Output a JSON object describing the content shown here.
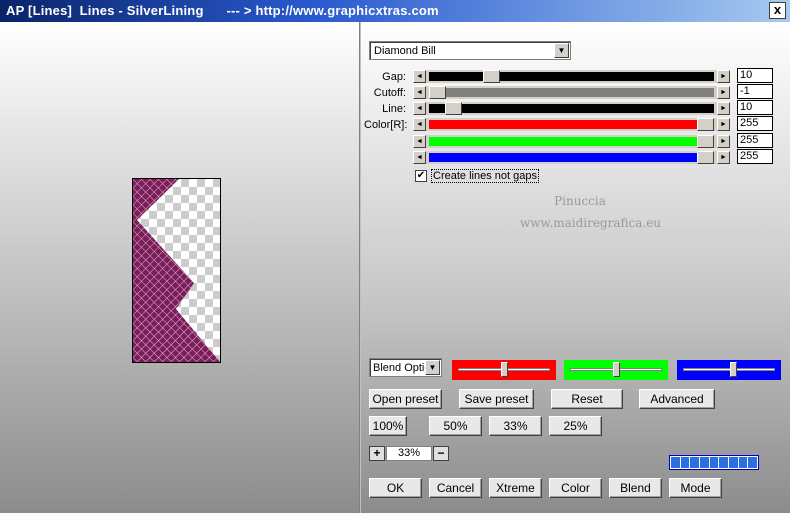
{
  "window": {
    "title": "AP [Lines]  Lines - SilverLining      --- > http://www.graphicxtras.com",
    "close_label": "x"
  },
  "preset": {
    "value": "Diamond Bill"
  },
  "sliders": [
    {
      "label": "Gap:",
      "value": "10",
      "color": "#000000",
      "level": 0.2
    },
    {
      "label": "Cutoff:",
      "value": "-1",
      "color": "#808080",
      "level": 0.0
    },
    {
      "label": "Line:",
      "value": "10",
      "color": "#000000",
      "level": 0.06
    },
    {
      "label": "Color[R]:",
      "value": "255",
      "color": "#ff0000",
      "level": 1.0
    },
    {
      "label": "",
      "value": "255",
      "color": "#00ff00",
      "level": 1.0
    },
    {
      "label": "",
      "value": "255",
      "color": "#0000ff",
      "level": 1.0
    }
  ],
  "checkbox": {
    "label": "Create lines not gaps",
    "checked": true
  },
  "watermark": {
    "line1": "Pinuccia",
    "line2": "www.maidiregrafica.eu"
  },
  "blend": {
    "value": "Blend Options"
  },
  "color_bars": [
    {
      "color": "#ff0000",
      "level": 0.5
    },
    {
      "color": "#00ff00",
      "level": 0.5
    },
    {
      "color": "#0000ff",
      "level": 0.55
    }
  ],
  "buttons": {
    "open_preset": "Open preset",
    "save_preset": "Save preset",
    "reset": "Reset",
    "advanced": "Advanced",
    "z100": "100%",
    "z50": "50%",
    "z33": "33%",
    "z25": "25%",
    "ok": "OK",
    "cancel": "Cancel",
    "xtreme": "Xtreme",
    "color": "Color",
    "blend": "Blend",
    "mode": "Mode"
  },
  "zoom": {
    "plus": "+",
    "value": "33%",
    "minus": "−"
  },
  "progress": {
    "segments": 9,
    "filled": 9
  }
}
